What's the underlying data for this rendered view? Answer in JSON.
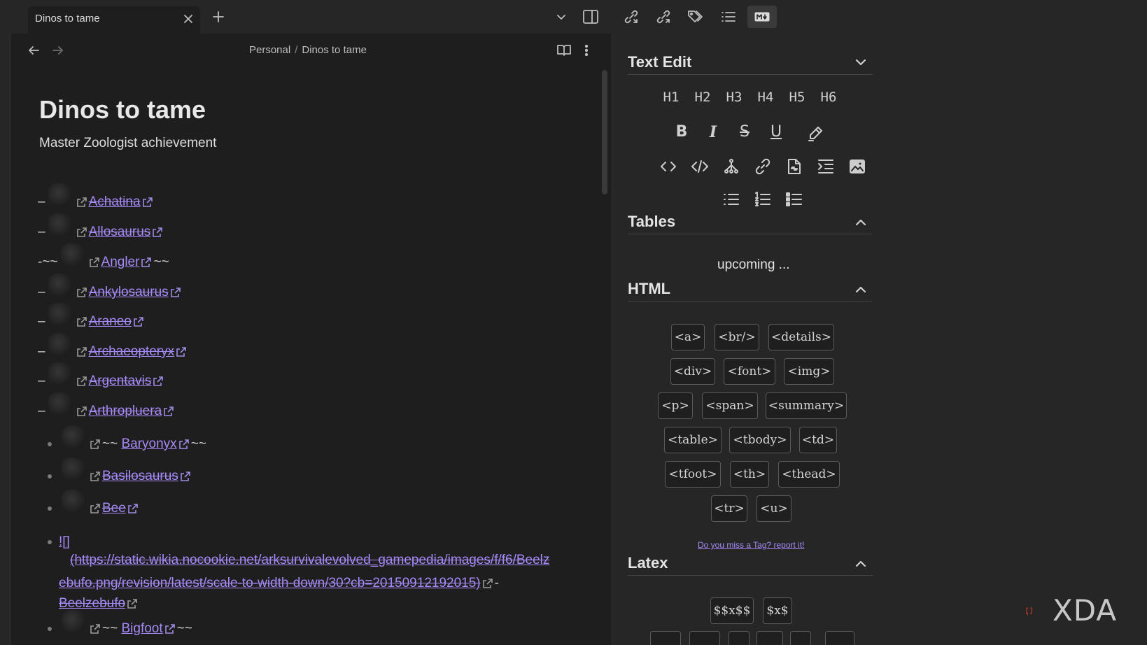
{
  "tab": {
    "title": "Dinos to tame"
  },
  "breadcrumb": {
    "folder": "Personal",
    "separator": "/",
    "note": "Dinos to tame"
  },
  "document": {
    "title": "Dinos to tame",
    "subtitle": "Master Zoologist achievement",
    "items": [
      {
        "name": "Achatina",
        "style": "strike",
        "prefix": "–"
      },
      {
        "name": "Allosaurus",
        "style": "strike",
        "prefix": "–"
      },
      {
        "name": "Angler",
        "style": "tilde",
        "prefix": "-~~"
      },
      {
        "name": "Ankylosaurus",
        "style": "strike",
        "prefix": "–"
      },
      {
        "name": "Araneo",
        "style": "strike",
        "prefix": "–"
      },
      {
        "name": "Archaeopteryx",
        "style": "strike",
        "prefix": "–"
      },
      {
        "name": "Argentavis",
        "style": "strike",
        "prefix": "–"
      },
      {
        "name": "Arthropluera",
        "style": "strike",
        "prefix": "–"
      }
    ],
    "bullets": [
      {
        "name": "Baryonyx",
        "style": "tilde"
      },
      {
        "name": "Basilosaurus",
        "style": "strike"
      },
      {
        "name": "Bee",
        "style": "strike"
      }
    ],
    "raw_prefix": "![]",
    "raw_url_line1": "(https://static.wikia.nocookie.net/arksurvivalevolved_gamepedia/images/f/f6/Beelz",
    "raw_url_line2": "ebufo.png/revision/latest/scale-to-width-down/30?cb=20150912192015)",
    "raw_suffix": "-",
    "raw_name": "Beelzebufo",
    "last_bullet": {
      "name": "Bigfoot",
      "style": "tilde"
    },
    "tilde": "~~"
  },
  "panel": {
    "text_edit": {
      "title": "Text Edit",
      "headings": [
        "H1",
        "H2",
        "H3",
        "H4",
        "H5",
        "H6"
      ]
    },
    "tables": {
      "title": "Tables",
      "placeholder": "upcoming ..."
    },
    "html": {
      "title": "HTML",
      "tags": [
        "<a>",
        "<br/>",
        "<details>",
        "<div>",
        "<font>",
        "<img>",
        "<p>",
        "<span>",
        "<summary>",
        "<table>",
        "<tbody>",
        "<td>",
        "<tfoot>",
        "<th>",
        "<thead>",
        "<tr>",
        "<u>"
      ],
      "report_link": "Do you miss a Tag? report it!"
    },
    "latex": {
      "title": "Latex",
      "tags": [
        "$$x$$",
        "$x$"
      ]
    }
  },
  "watermark": {
    "text": "XDA"
  },
  "colors": {
    "accent": "#a68af9",
    "bg": "#1e1e1e",
    "panel": "#262626"
  }
}
